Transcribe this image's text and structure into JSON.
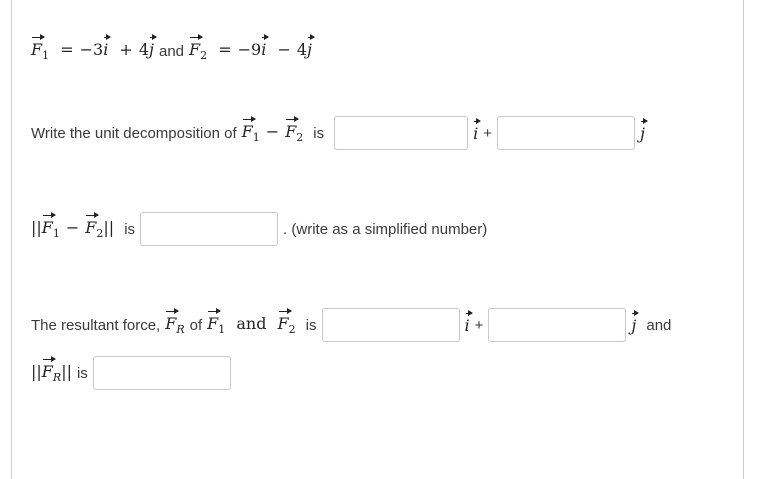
{
  "given": {
    "f1_coef_i": "−3",
    "f1_coef_j": "4",
    "and": "and",
    "f2_coef_i": "−9",
    "f2_coef_j": "4"
  },
  "q1": {
    "prompt": "Write the unit decomposition of",
    "is": "is",
    "plus": "+"
  },
  "q2": {
    "is": "is",
    "note": ". (write as a simplified number)"
  },
  "q3": {
    "prompt": "The resultant force,",
    "of": "of",
    "and": "and",
    "is": "is",
    "plus": "+",
    "trailing_and": "and"
  },
  "q4": {
    "is": "is"
  },
  "symbols": {
    "F": "F",
    "i": "i",
    "j": "j",
    "sub1": "1",
    "sub2": "2",
    "subR": "R",
    "eq": "=",
    "minus": "−",
    "plus": "+",
    "norm": "||"
  }
}
